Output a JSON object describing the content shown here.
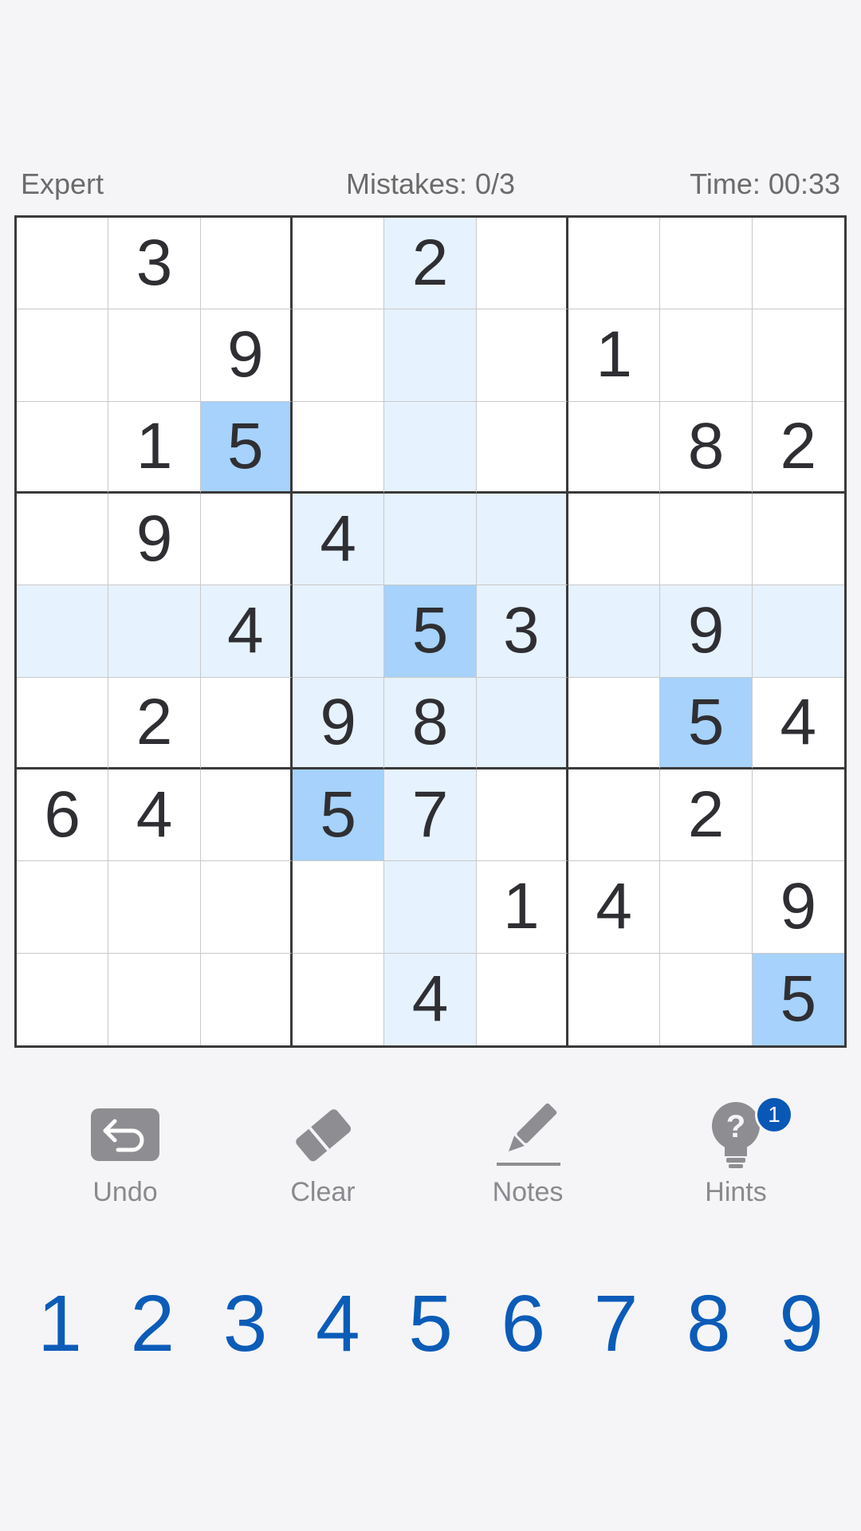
{
  "status": {
    "difficulty": "Expert",
    "mistakes": "Mistakes: 0/3",
    "time": "Time: 00:33"
  },
  "board": [
    [
      "",
      "3",
      "",
      "",
      "2",
      "",
      "",
      "",
      ""
    ],
    [
      "",
      "",
      "9",
      "",
      "",
      "",
      "1",
      "",
      ""
    ],
    [
      "",
      "1",
      "5",
      "",
      "",
      "",
      "",
      "8",
      "2"
    ],
    [
      "",
      "9",
      "",
      "4",
      "",
      "",
      "",
      "",
      ""
    ],
    [
      "",
      "",
      "4",
      "",
      "5",
      "3",
      "",
      "9",
      ""
    ],
    [
      "",
      "2",
      "",
      "9",
      "8",
      "",
      "",
      "5",
      "4"
    ],
    [
      "6",
      "4",
      "",
      "5",
      "7",
      "",
      "",
      "2",
      ""
    ],
    [
      "",
      "",
      "",
      "",
      "",
      "1",
      "4",
      "",
      "9"
    ],
    [
      "",
      "",
      "",
      "",
      "4",
      "",
      "",
      "",
      "5"
    ]
  ],
  "selected_cell": {
    "row": 4,
    "col": 4
  },
  "tools": {
    "undo": "Undo",
    "clear": "Clear",
    "notes": "Notes",
    "hints": "Hints",
    "hints_badge": "1"
  },
  "numpad": [
    "1",
    "2",
    "3",
    "4",
    "5",
    "6",
    "7",
    "8",
    "9"
  ],
  "colors": {
    "highlight": "#e6f2fd",
    "match": "#a6d2fb",
    "numpad": "#0b5cb8",
    "badge": "#0a58b6"
  }
}
